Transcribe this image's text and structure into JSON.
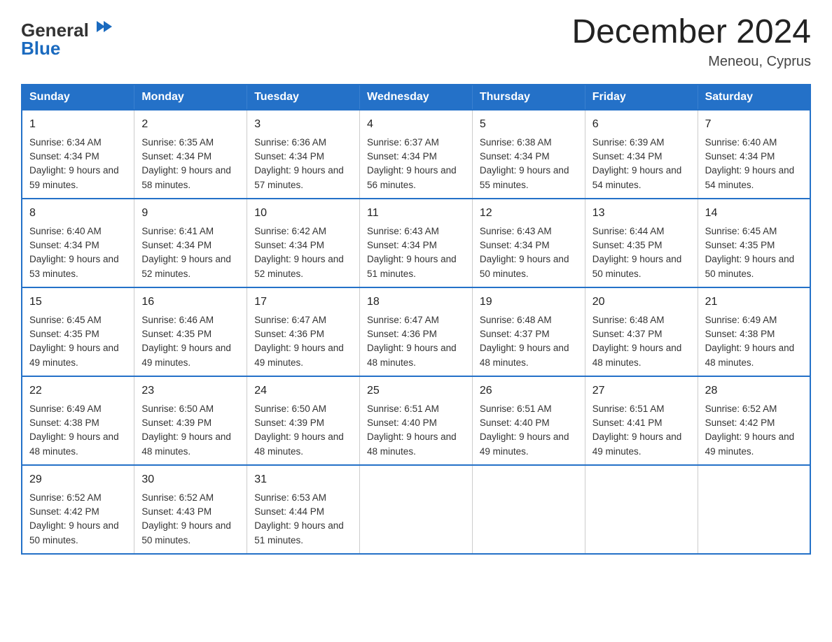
{
  "logo": {
    "general": "General",
    "blue": "Blue"
  },
  "title": "December 2024",
  "location": "Meneou, Cyprus",
  "days_of_week": [
    "Sunday",
    "Monday",
    "Tuesday",
    "Wednesday",
    "Thursday",
    "Friday",
    "Saturday"
  ],
  "weeks": [
    [
      {
        "day": "1",
        "sunrise": "6:34 AM",
        "sunset": "4:34 PM",
        "daylight": "9 hours and 59 minutes."
      },
      {
        "day": "2",
        "sunrise": "6:35 AM",
        "sunset": "4:34 PM",
        "daylight": "9 hours and 58 minutes."
      },
      {
        "day": "3",
        "sunrise": "6:36 AM",
        "sunset": "4:34 PM",
        "daylight": "9 hours and 57 minutes."
      },
      {
        "day": "4",
        "sunrise": "6:37 AM",
        "sunset": "4:34 PM",
        "daylight": "9 hours and 56 minutes."
      },
      {
        "day": "5",
        "sunrise": "6:38 AM",
        "sunset": "4:34 PM",
        "daylight": "9 hours and 55 minutes."
      },
      {
        "day": "6",
        "sunrise": "6:39 AM",
        "sunset": "4:34 PM",
        "daylight": "9 hours and 54 minutes."
      },
      {
        "day": "7",
        "sunrise": "6:40 AM",
        "sunset": "4:34 PM",
        "daylight": "9 hours and 54 minutes."
      }
    ],
    [
      {
        "day": "8",
        "sunrise": "6:40 AM",
        "sunset": "4:34 PM",
        "daylight": "9 hours and 53 minutes."
      },
      {
        "day": "9",
        "sunrise": "6:41 AM",
        "sunset": "4:34 PM",
        "daylight": "9 hours and 52 minutes."
      },
      {
        "day": "10",
        "sunrise": "6:42 AM",
        "sunset": "4:34 PM",
        "daylight": "9 hours and 52 minutes."
      },
      {
        "day": "11",
        "sunrise": "6:43 AM",
        "sunset": "4:34 PM",
        "daylight": "9 hours and 51 minutes."
      },
      {
        "day": "12",
        "sunrise": "6:43 AM",
        "sunset": "4:34 PM",
        "daylight": "9 hours and 50 minutes."
      },
      {
        "day": "13",
        "sunrise": "6:44 AM",
        "sunset": "4:35 PM",
        "daylight": "9 hours and 50 minutes."
      },
      {
        "day": "14",
        "sunrise": "6:45 AM",
        "sunset": "4:35 PM",
        "daylight": "9 hours and 50 minutes."
      }
    ],
    [
      {
        "day": "15",
        "sunrise": "6:45 AM",
        "sunset": "4:35 PM",
        "daylight": "9 hours and 49 minutes."
      },
      {
        "day": "16",
        "sunrise": "6:46 AM",
        "sunset": "4:35 PM",
        "daylight": "9 hours and 49 minutes."
      },
      {
        "day": "17",
        "sunrise": "6:47 AM",
        "sunset": "4:36 PM",
        "daylight": "9 hours and 49 minutes."
      },
      {
        "day": "18",
        "sunrise": "6:47 AM",
        "sunset": "4:36 PM",
        "daylight": "9 hours and 48 minutes."
      },
      {
        "day": "19",
        "sunrise": "6:48 AM",
        "sunset": "4:37 PM",
        "daylight": "9 hours and 48 minutes."
      },
      {
        "day": "20",
        "sunrise": "6:48 AM",
        "sunset": "4:37 PM",
        "daylight": "9 hours and 48 minutes."
      },
      {
        "day": "21",
        "sunrise": "6:49 AM",
        "sunset": "4:38 PM",
        "daylight": "9 hours and 48 minutes."
      }
    ],
    [
      {
        "day": "22",
        "sunrise": "6:49 AM",
        "sunset": "4:38 PM",
        "daylight": "9 hours and 48 minutes."
      },
      {
        "day": "23",
        "sunrise": "6:50 AM",
        "sunset": "4:39 PM",
        "daylight": "9 hours and 48 minutes."
      },
      {
        "day": "24",
        "sunrise": "6:50 AM",
        "sunset": "4:39 PM",
        "daylight": "9 hours and 48 minutes."
      },
      {
        "day": "25",
        "sunrise": "6:51 AM",
        "sunset": "4:40 PM",
        "daylight": "9 hours and 48 minutes."
      },
      {
        "day": "26",
        "sunrise": "6:51 AM",
        "sunset": "4:40 PM",
        "daylight": "9 hours and 49 minutes."
      },
      {
        "day": "27",
        "sunrise": "6:51 AM",
        "sunset": "4:41 PM",
        "daylight": "9 hours and 49 minutes."
      },
      {
        "day": "28",
        "sunrise": "6:52 AM",
        "sunset": "4:42 PM",
        "daylight": "9 hours and 49 minutes."
      }
    ],
    [
      {
        "day": "29",
        "sunrise": "6:52 AM",
        "sunset": "4:42 PM",
        "daylight": "9 hours and 50 minutes."
      },
      {
        "day": "30",
        "sunrise": "6:52 AM",
        "sunset": "4:43 PM",
        "daylight": "9 hours and 50 minutes."
      },
      {
        "day": "31",
        "sunrise": "6:53 AM",
        "sunset": "4:44 PM",
        "daylight": "9 hours and 51 minutes."
      },
      null,
      null,
      null,
      null
    ]
  ]
}
